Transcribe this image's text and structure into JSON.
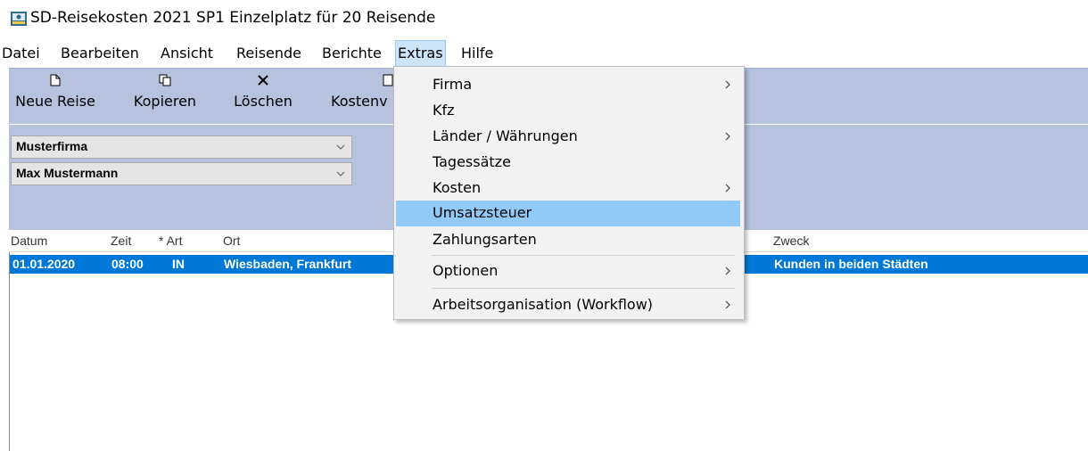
{
  "window": {
    "title": "SD-Reisekosten 2021 SP1 Einzelplatz für 20 Reisende",
    "icon": "app-icon"
  },
  "menubar": {
    "items": [
      {
        "label": "Datei"
      },
      {
        "label": "Bearbeiten"
      },
      {
        "label": "Ansicht"
      },
      {
        "label": "Reisende"
      },
      {
        "label": "Berichte"
      },
      {
        "label": "Extras",
        "active": true
      },
      {
        "label": "Hilfe"
      }
    ]
  },
  "toolbar": {
    "buttons": [
      {
        "label": "Neue Reise",
        "icon": "new-document-icon"
      },
      {
        "label": "Kopieren",
        "icon": "copy-icon"
      },
      {
        "label": "Löschen",
        "icon": "delete-x-icon"
      },
      {
        "label": "Kostenv",
        "icon": "document-icon"
      }
    ]
  },
  "filters": {
    "company": {
      "value": "Musterfirma"
    },
    "traveler": {
      "value": "Max Mustermann"
    }
  },
  "table": {
    "columns": [
      "Datum",
      "Zeit",
      "* Art",
      "Ort",
      "Zweck"
    ],
    "rows": [
      {
        "datum": "01.01.2020",
        "zeit": "08:00",
        "art": "IN",
        "ort": "Wiesbaden, Frankfurt",
        "zweck": "Kunden in beiden Städten",
        "selected": true
      }
    ]
  },
  "extras_menu": {
    "items": [
      {
        "label": "Firma",
        "submenu": true
      },
      {
        "label": "Kfz",
        "submenu": false
      },
      {
        "label": "Länder / Währungen",
        "submenu": true
      },
      {
        "label": "Tagessätze",
        "submenu": false
      },
      {
        "label": "Kosten",
        "submenu": true
      },
      {
        "label": "Umsatzsteuer",
        "submenu": false,
        "highlighted": true
      },
      {
        "label": "Zahlungsarten",
        "submenu": false
      },
      {
        "label": "Optionen",
        "submenu": true
      },
      {
        "label": "Arbeitsorganisation (Workflow)",
        "submenu": true
      }
    ]
  },
  "colors": {
    "toolbar_bg": "#b6c2de",
    "selection": "#0078d7",
    "menu_highlight": "#91c9f7",
    "menu_active": "#cce4f7"
  }
}
